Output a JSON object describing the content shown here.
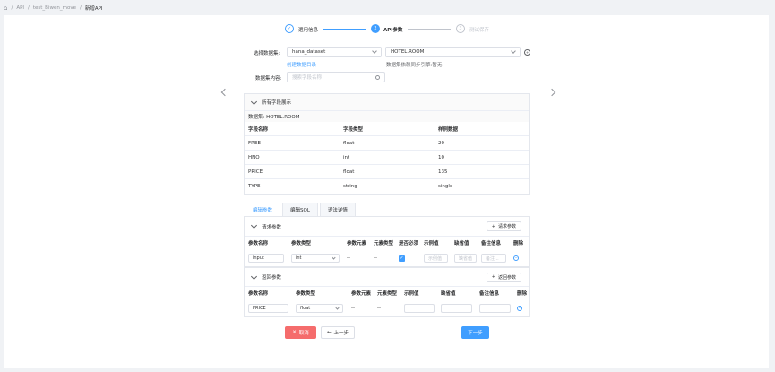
{
  "breadcrumb": {
    "home": "⌂",
    "items": [
      "API",
      "test_Biwen_move",
      "新增API"
    ],
    "sep": "/"
  },
  "steps": [
    {
      "label": "選用信息",
      "num": "✓"
    },
    {
      "label": "API参数",
      "num": "2"
    },
    {
      "label": "测试保存",
      "num": "3"
    }
  ],
  "form": {
    "dataset_label": "选择数据集:",
    "dataset_value": "hana_dataset",
    "table_value": "HOTEL.ROOM",
    "create_link": "创建数据目录",
    "sync_note": "数据集依赖同步引擎:暂无",
    "content_label": "数据集内容:",
    "search_placeholder": "搜索字段名称"
  },
  "fields_panel": {
    "title": "所有字段展示",
    "dataset_line": "数据集: HOTEL.ROOM",
    "headers": [
      "字段名称",
      "字段类型",
      "样例数据"
    ],
    "rows": [
      [
        "FREE",
        "float",
        "20"
      ],
      [
        "HNO",
        "int",
        "10"
      ],
      [
        "PRICE",
        "float",
        "135"
      ],
      [
        "TYPE",
        "string",
        "single"
      ]
    ]
  },
  "tabs": [
    "编辑参数",
    "编辑SQL",
    "语法详情"
  ],
  "request": {
    "title": "请求参数",
    "add_label": "请求参数",
    "headers": [
      "参数名称",
      "参数类型",
      "参数元素",
      "元素类型",
      "是否必须",
      "示例值",
      "缺省值",
      "备注信息",
      "删除"
    ],
    "row": {
      "name": "input",
      "type": "int",
      "element": "--",
      "element_type": "--",
      "example_ph": "示例值",
      "default_ph": "缺省值",
      "remark_ph": "备注..."
    }
  },
  "response": {
    "title": "返回参数",
    "add_label": "返回参数",
    "headers": [
      "参数名称",
      "参数类型",
      "参数元素",
      "元素类型",
      "示例值",
      "缺省值",
      "备注信息",
      "删除"
    ],
    "row": {
      "name": "PRICE",
      "type": "float",
      "element": "--",
      "element_type": "--"
    }
  },
  "buttons": {
    "cancel": "取消",
    "prev": "上一步",
    "next": "下一步"
  },
  "colors": {
    "primary": "#409eff",
    "danger": "#f56c6c",
    "border": "#dcdfe6"
  }
}
